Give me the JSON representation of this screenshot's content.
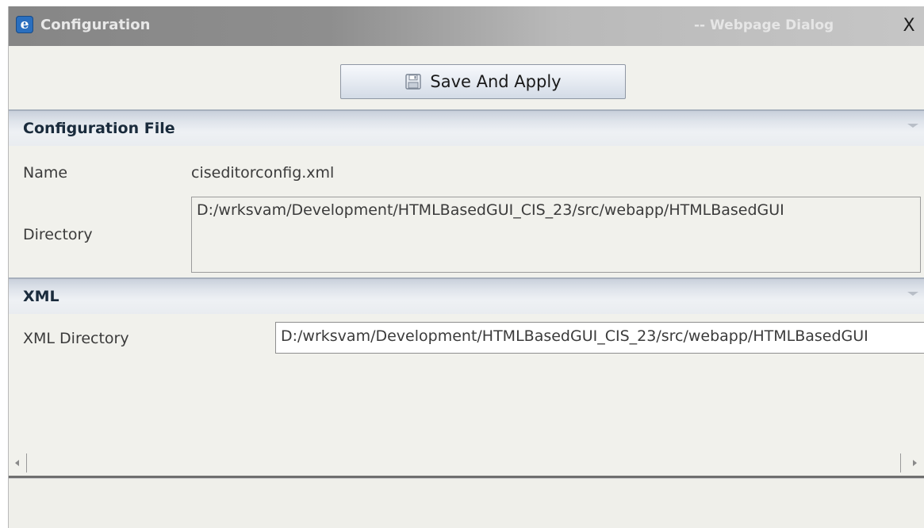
{
  "window": {
    "title": "Configuration",
    "title_suffix": "-- Webpage Dialog",
    "close_glyph": "X"
  },
  "toolbar": {
    "save_label": "Save And Apply",
    "save_icon": "floppy-disk-icon"
  },
  "config_file_section": {
    "title": "Configuration File",
    "name_label": "Name",
    "name_value": "ciseditorconfig.xml",
    "directory_label": "Directory",
    "directory_value": "D:/wrksvam/Development/HTMLBasedGUI_CIS_23/src/webapp/HTMLBasedGUI"
  },
  "xml_section": {
    "title": "XML",
    "xml_directory_label": "XML Directory",
    "xml_directory_value": "D:/wrksvam/Development/HTMLBasedGUI_CIS_23/src/webapp/HTMLBasedGUI"
  },
  "colors": {
    "titlebar": "#8e8e8e",
    "background": "#f1f1ec",
    "section_header": "#dfe4eb",
    "section_title": "#1a2b3c"
  }
}
